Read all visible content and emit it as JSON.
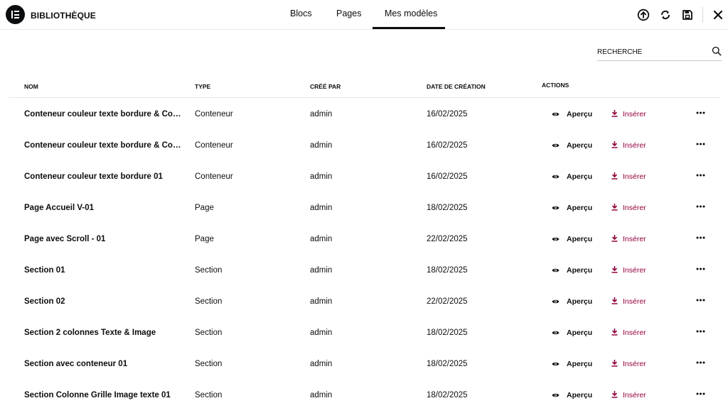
{
  "header": {
    "title": "BIBLIOTHÈQUE",
    "logo_icon": "elementor-logo",
    "tabs": [
      {
        "label": "Blocs"
      },
      {
        "label": "Pages"
      },
      {
        "label": "Mes modèles"
      }
    ],
    "active_tab": "Mes modèles",
    "actions": [
      "upload-icon",
      "sync-icon",
      "save-icon",
      "close-icon"
    ]
  },
  "search": {
    "placeholder": "RECHERCHE",
    "value": ""
  },
  "table": {
    "columns": {
      "name": "NOM",
      "type": "TYPE",
      "author": "CRÉÉ PAR",
      "date": "DATE DE CRÉATION",
      "actions": "ACTIONS"
    },
    "preview_label": "Aperçu",
    "insert_label": "Insérer",
    "rows": [
      {
        "name": "Conteneur couleur texte bordure & Conteneur",
        "type": "Conteneur",
        "author": "admin",
        "date": "16/02/2025"
      },
      {
        "name": "Conteneur couleur texte bordure & Conteneur",
        "type": "Conteneur",
        "author": "admin",
        "date": "16/02/2025"
      },
      {
        "name": "Conteneur couleur texte bordure 01",
        "type": "Conteneur",
        "author": "admin",
        "date": "16/02/2025"
      },
      {
        "name": "Page Accueil V-01",
        "type": "Page",
        "author": "admin",
        "date": "18/02/2025"
      },
      {
        "name": "Page avec Scroll - 01",
        "type": "Page",
        "author": "admin",
        "date": "22/02/2025"
      },
      {
        "name": "Section 01",
        "type": "Section",
        "author": "admin",
        "date": "18/02/2025"
      },
      {
        "name": "Section 02",
        "type": "Section",
        "author": "admin",
        "date": "22/02/2025"
      },
      {
        "name": "Section 2 colonnes Texte & Image",
        "type": "Section",
        "author": "admin",
        "date": "18/02/2025"
      },
      {
        "name": "Section avec conteneur 01",
        "type": "Section",
        "author": "admin",
        "date": "18/02/2025"
      },
      {
        "name": "Section Colonne Grille Image texte 01",
        "type": "Section",
        "author": "admin",
        "date": "18/02/2025"
      }
    ]
  },
  "colors": {
    "text": "#0c0d0e",
    "insert_accent": "#93003c",
    "border": "#e6e8ea"
  }
}
